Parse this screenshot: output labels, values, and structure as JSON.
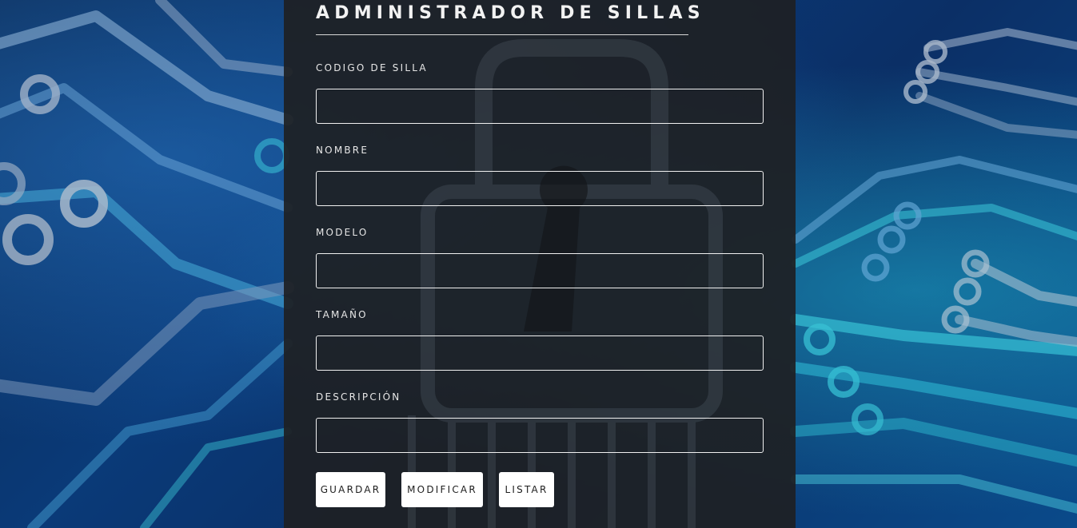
{
  "form": {
    "title": "ADMINISTRADOR DE SILLAS",
    "fields": [
      {
        "label": "CODIGO DE SILLA",
        "value": "",
        "placeholder": ""
      },
      {
        "label": "NOMBRE",
        "value": "",
        "placeholder": ""
      },
      {
        "label": "MODELO",
        "value": "",
        "placeholder": ""
      },
      {
        "label": "TAMAÑO",
        "value": "",
        "placeholder": ""
      },
      {
        "label": "DESCRIPCIÓN",
        "value": "",
        "placeholder": ""
      }
    ],
    "buttons": {
      "save": "GUARDAR",
      "modify": "MODIFICAR",
      "list": "LISTAR"
    }
  },
  "background": {
    "image": "circuit-board-with-padlock",
    "colors": {
      "deep_blue": "#0a3a78",
      "cyan_trace": "#3fd1e0",
      "panel": "#1e2024",
      "button": "#ffffff"
    }
  }
}
